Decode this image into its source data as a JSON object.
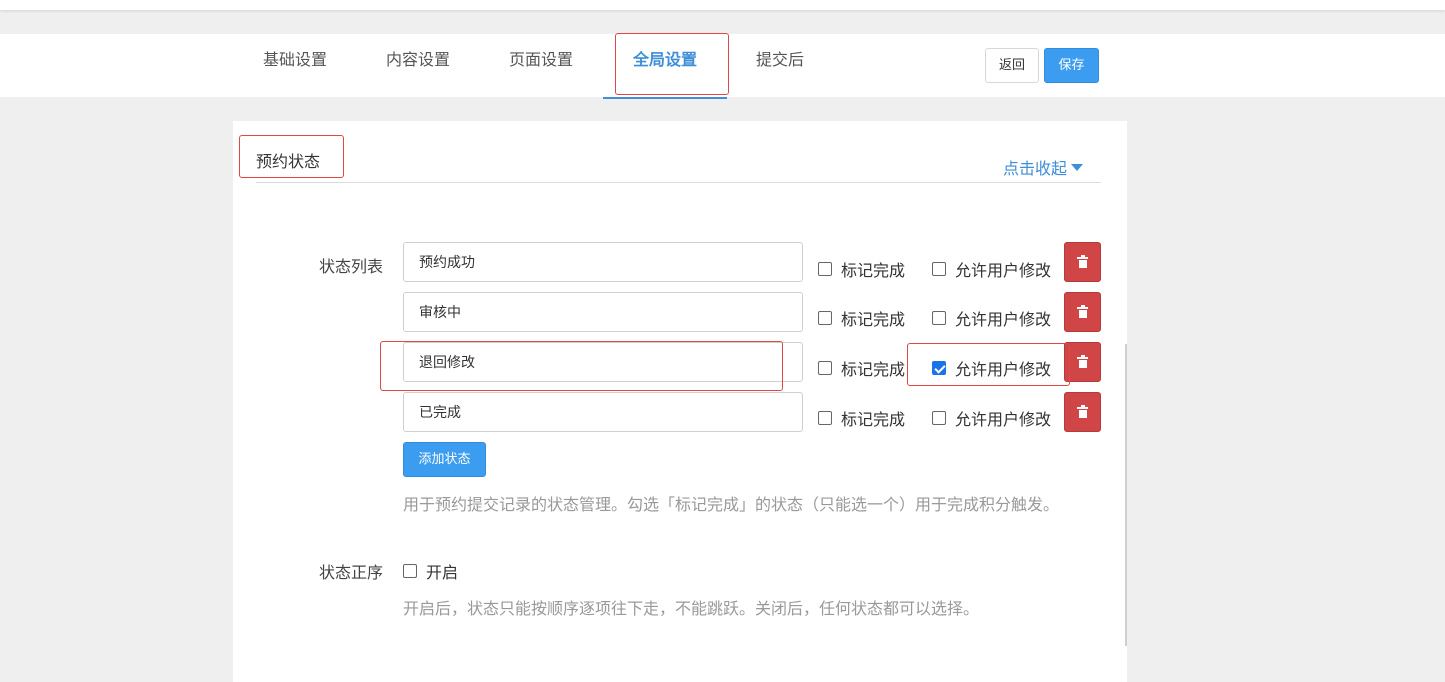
{
  "tabs": [
    {
      "label": "基础设置",
      "active": false
    },
    {
      "label": "内容设置",
      "active": false
    },
    {
      "label": "页面设置",
      "active": false
    },
    {
      "label": "全局设置",
      "active": true
    },
    {
      "label": "提交后",
      "active": false
    }
  ],
  "toolbar": {
    "back_label": "返回",
    "save_label": "保存"
  },
  "section": {
    "title": "预约状态",
    "collapse_label": "点击收起"
  },
  "status_list": {
    "label": "状态列表",
    "mark_done_label": "标记完成",
    "allow_edit_label": "允许用户修改",
    "items": [
      {
        "value": "预约成功",
        "mark_done": false,
        "allow_edit": false
      },
      {
        "value": "审核中",
        "mark_done": false,
        "allow_edit": false
      },
      {
        "value": "退回修改",
        "mark_done": false,
        "allow_edit": true
      },
      {
        "value": "已完成",
        "mark_done": false,
        "allow_edit": false
      }
    ],
    "add_label": "添加状态",
    "hint": "用于预约提交记录的状态管理。勾选「标记完成」的状态（只能选一个）用于完成积分触发。"
  },
  "status_order": {
    "label": "状态正序",
    "option_label": "开启",
    "enabled": false,
    "hint": "开启后，状态只能按顺序逐项往下走，不能跳跃。关闭后，任何状态都可以选择。"
  },
  "colors": {
    "accent": "#3e8ed8",
    "primary_button": "#3c9cf0",
    "danger": "#d04545",
    "highlight": "#e04848"
  }
}
